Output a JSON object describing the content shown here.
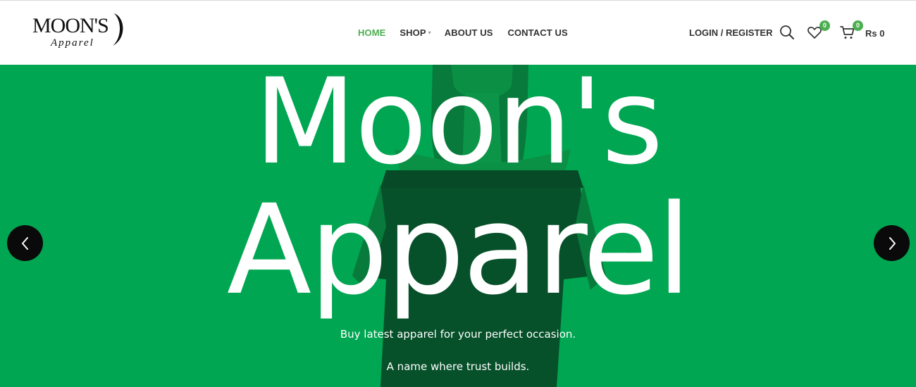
{
  "logo": {
    "word": "MOON'S",
    "tagline": "Apparel"
  },
  "nav": {
    "items": [
      {
        "label": "HOME",
        "active": true
      },
      {
        "label": "SHOP"
      },
      {
        "label": "ABOUT US"
      },
      {
        "label": "CONTACT US"
      }
    ]
  },
  "header": {
    "login_label": "LOGIN / REGISTER",
    "wishlist_count": "0",
    "cart_count": "0",
    "cart_total": "Rs 0"
  },
  "hero": {
    "title_line1": "Moon's",
    "title_line2": "Apparel",
    "subtitle_line1": "Buy latest apparel for your perfect occasion.",
    "subtitle_line2": "A name where trust builds."
  },
  "colors": {
    "accent": "#4caf50",
    "hero_bg": "#00a651",
    "dark": "#0a0a0a"
  },
  "icons": [
    "search-icon",
    "heart-icon",
    "cart-icon",
    "chevron-left-icon",
    "chevron-right-icon",
    "crescent-moon-icon"
  ]
}
